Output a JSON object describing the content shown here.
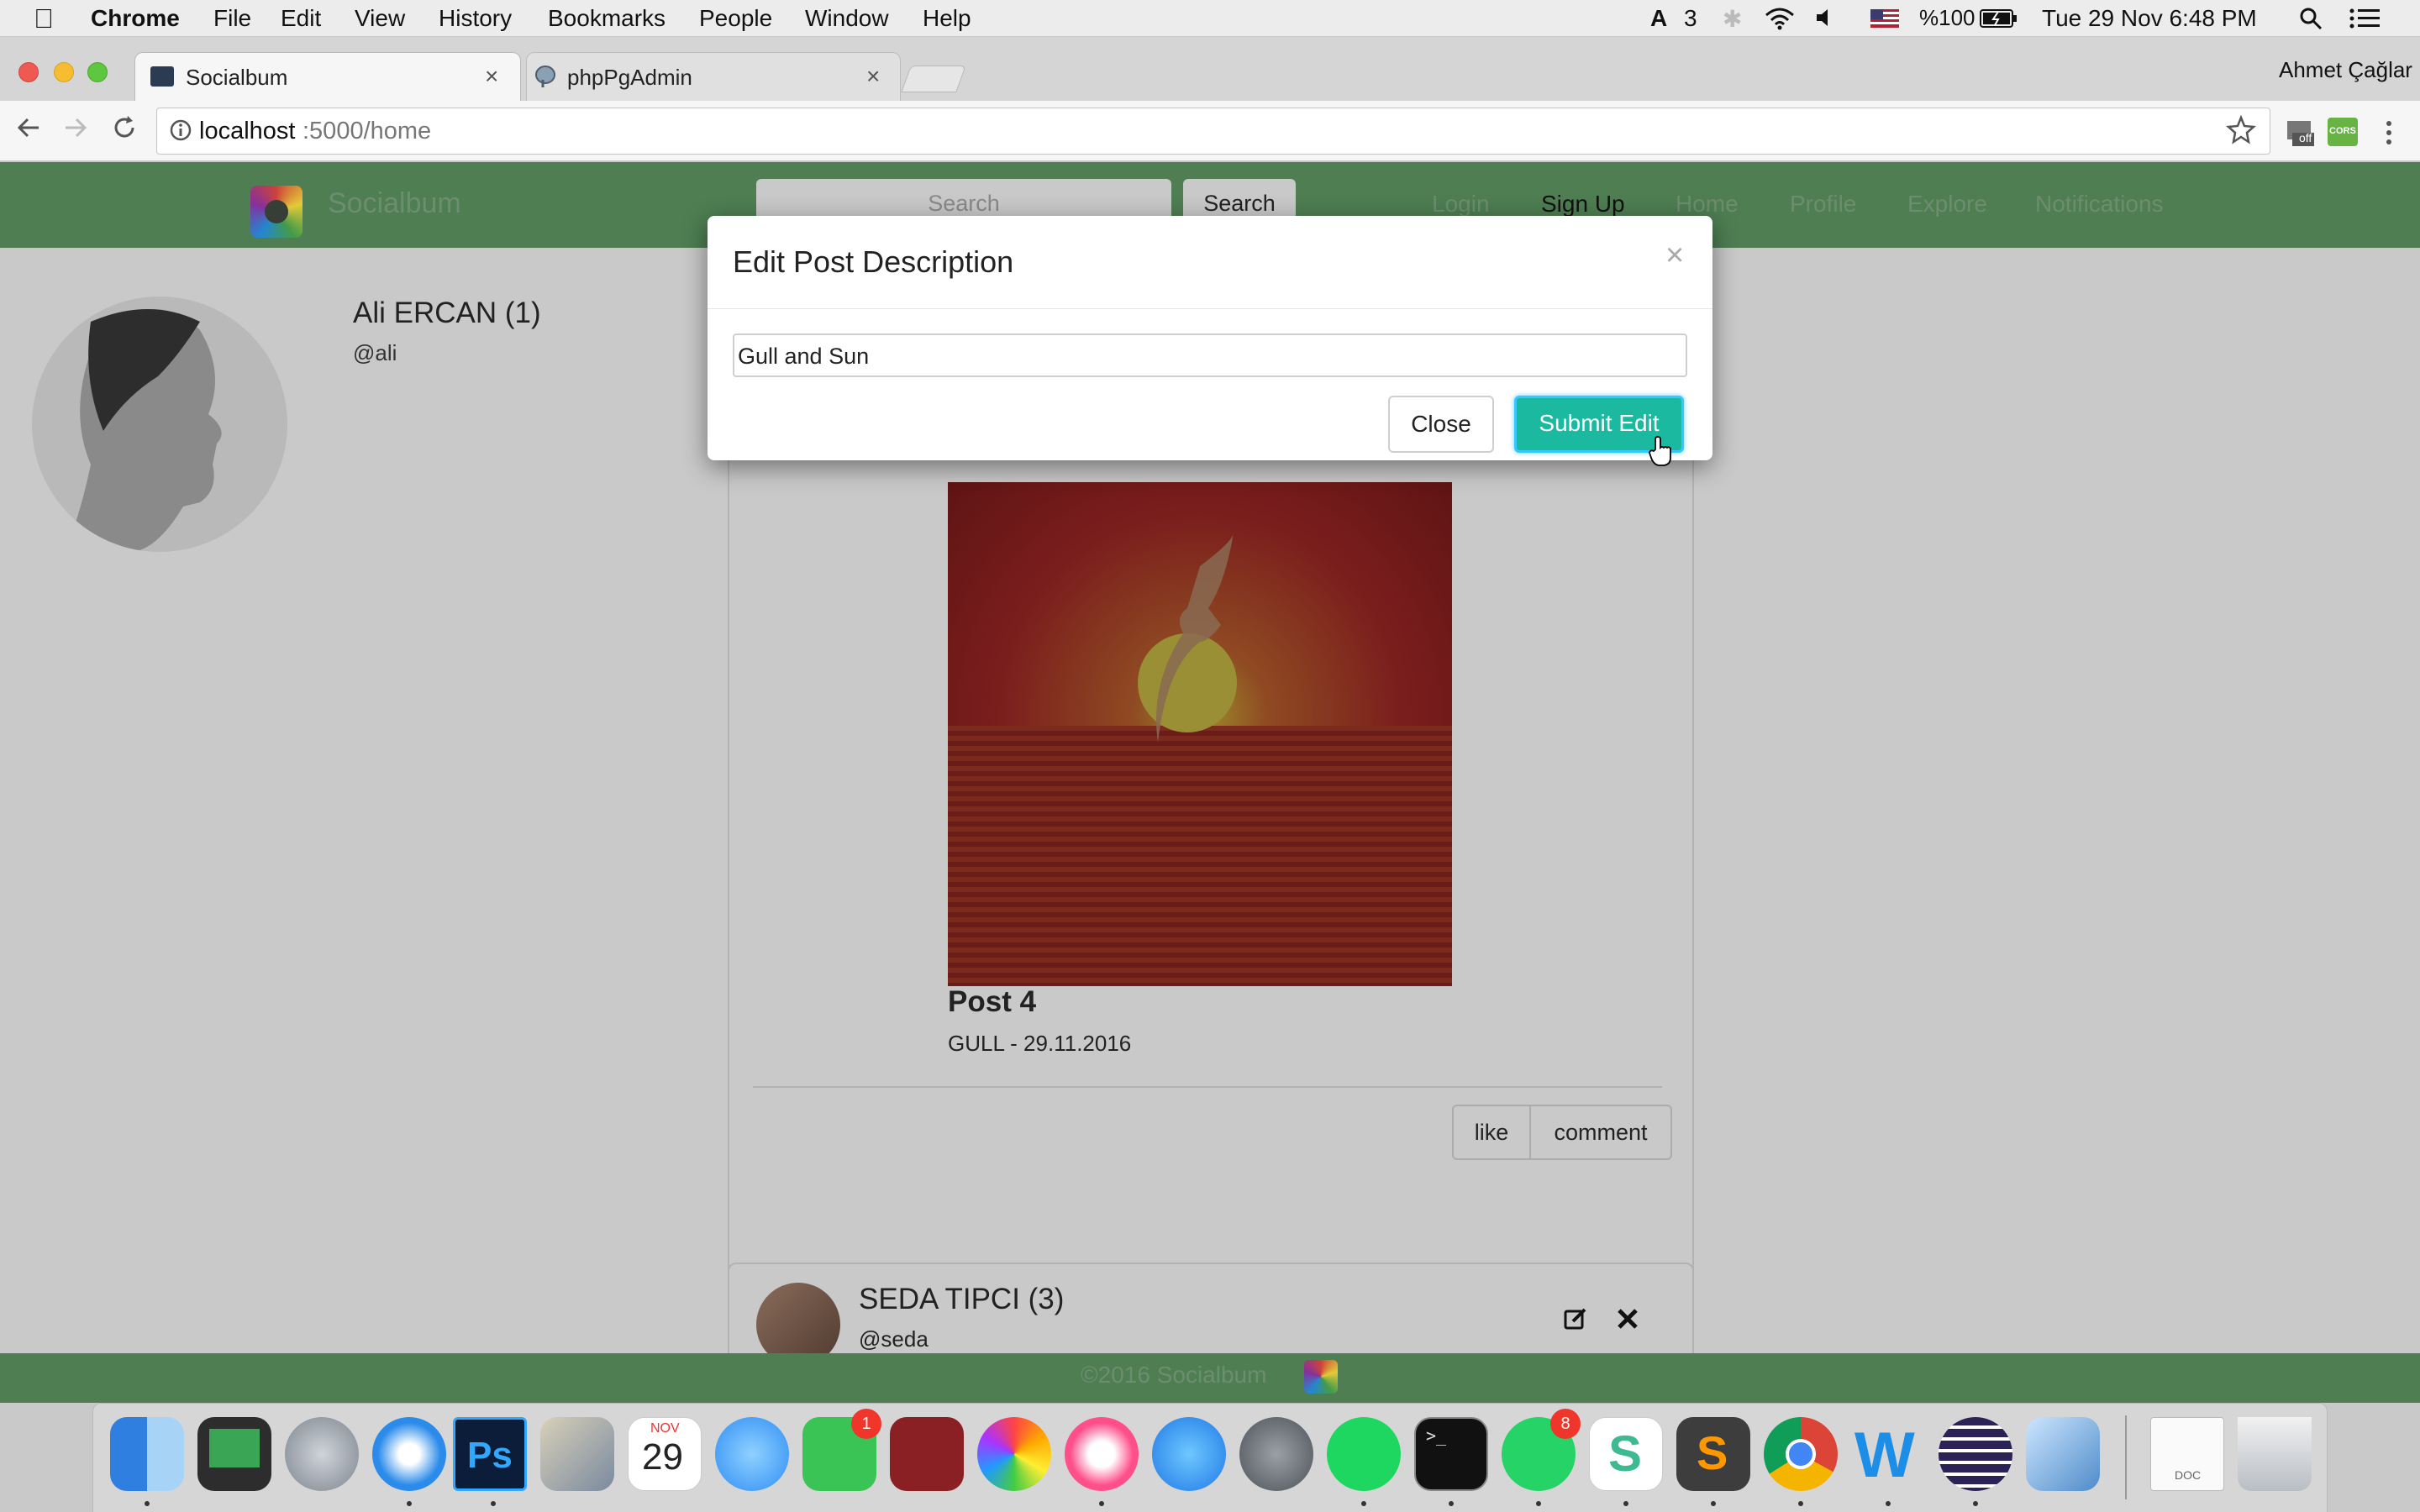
{
  "menubar": {
    "app_name": "Chrome",
    "menus": [
      "File",
      "Edit",
      "View",
      "History",
      "Bookmarks",
      "People",
      "Window",
      "Help"
    ],
    "status": {
      "adobe_count": "3",
      "battery": "%100",
      "datetime": "Tue 29 Nov  6:48 PM"
    }
  },
  "browser": {
    "profile_name": "Ahmet Çağlar",
    "tabs": [
      {
        "title": "Socialbum",
        "active": true
      },
      {
        "title": "phpPgAdmin",
        "active": false
      }
    ],
    "url_host": "localhost",
    "url_rest": ":5000/home",
    "extension_off_label": "off",
    "extension_cors_label": "CORS"
  },
  "site": {
    "brand": "Socialbum",
    "search_placeholder": "Search",
    "search_button": "Search",
    "nav": [
      "Login",
      "Sign Up",
      "Home",
      "Profile",
      "Explore",
      "Notifications"
    ],
    "footer": "©2016 Socialbum"
  },
  "profile": {
    "name": "Ali ERCAN (1)",
    "handle": "@ali"
  },
  "post": {
    "title": "Post 4",
    "description": "GULL - 29.11.2016",
    "like_button": "like",
    "comment_button": "comment"
  },
  "next_post": {
    "author": "SEDA TIPCI (3)",
    "handle": "@seda"
  },
  "modal": {
    "title": "Edit Post Description",
    "close_symbol": "×",
    "input_value": "Gull and Sun",
    "close_button": "Close",
    "submit_button": "Submit Edit",
    "submit_color": "#1ab9a0"
  },
  "dock": {
    "calendar_month": "NOV",
    "calendar_day": "29",
    "facetime_badge": "1",
    "whatsapp_badge": "8",
    "slack_letter": "S",
    "sublime_letter": "S",
    "word_letter": "W",
    "ps_label": "Ps",
    "terminal_prompt": ">_",
    "doc_label": "DOC"
  },
  "colors": {
    "navbar": "#4e7e52",
    "accent": "#1ab9a0",
    "overlay_page": "#c9c9c9"
  }
}
